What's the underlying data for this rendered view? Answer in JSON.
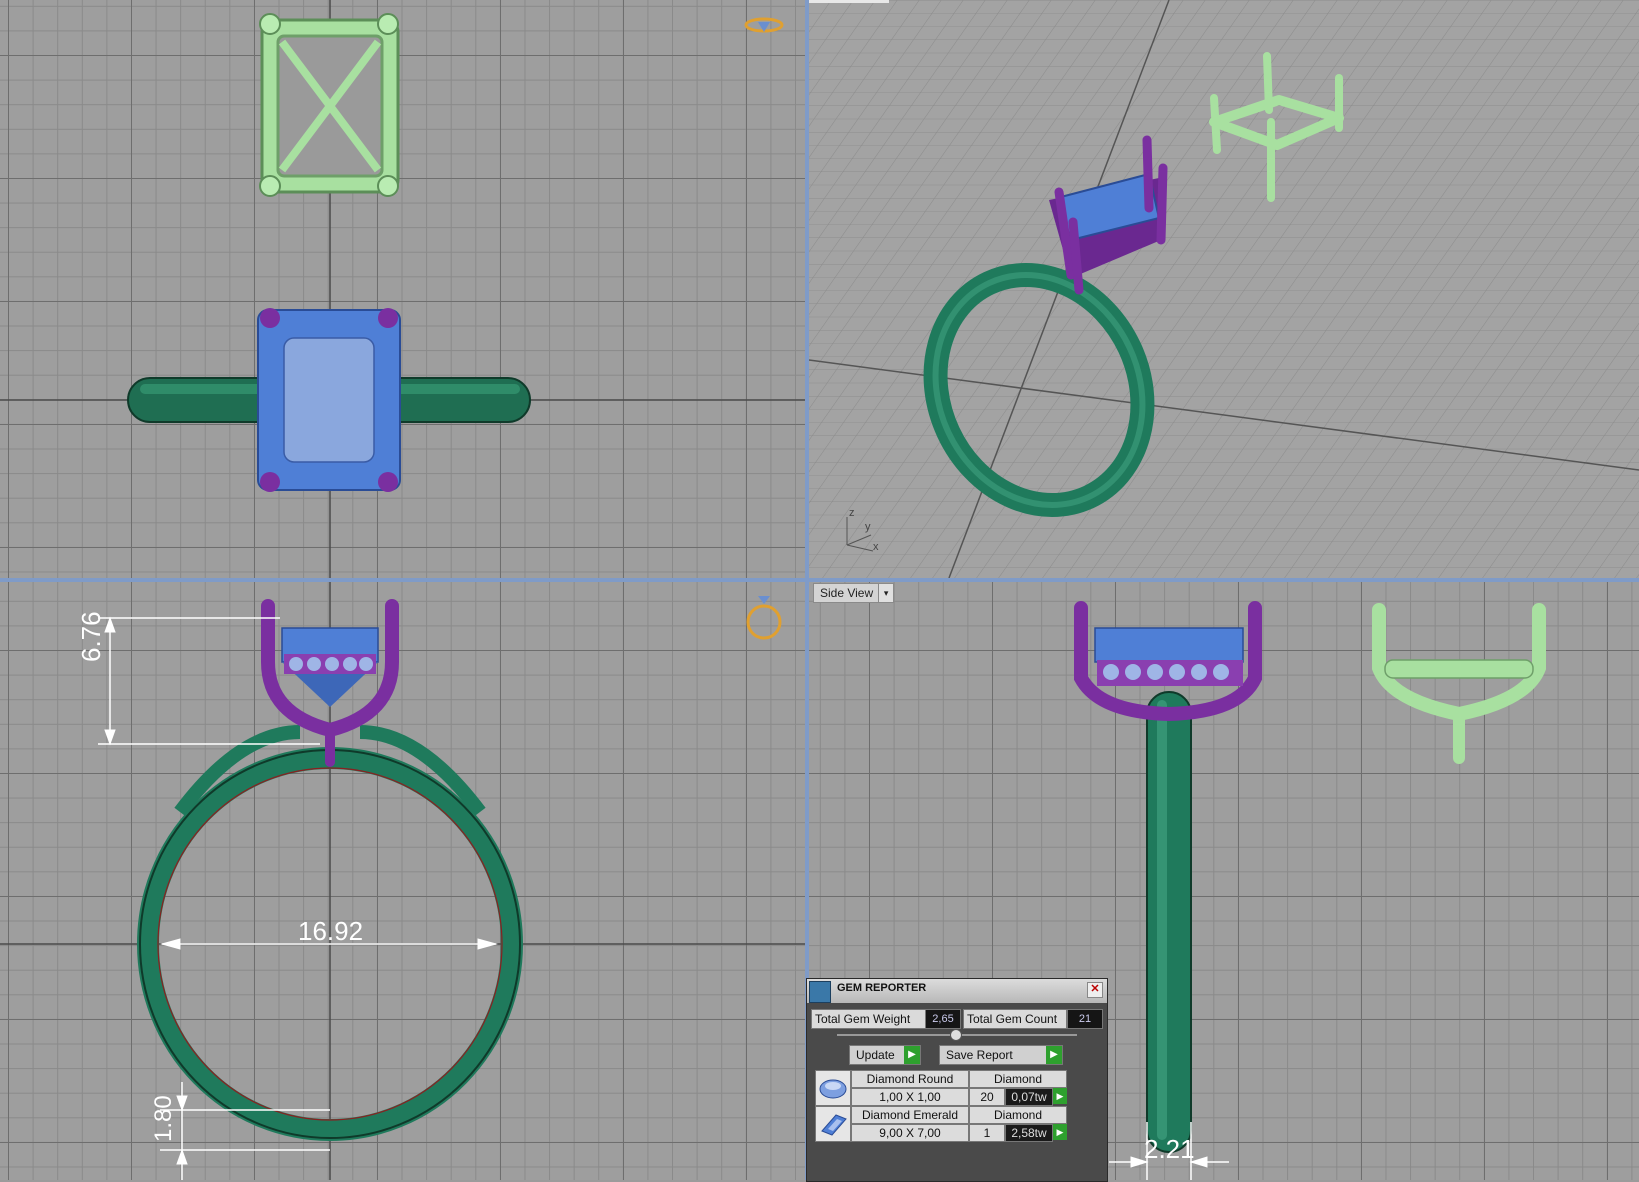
{
  "viewports": {
    "side_label": "Side View",
    "side_dropdown_glyph": "▾"
  },
  "dimensions": {
    "height": "6.76",
    "inner_diameter": "16.92",
    "band_thickness": "1.80",
    "band_width": "2.21"
  },
  "axes": {
    "x": "x",
    "y": "y",
    "z": "z"
  },
  "gem_reporter": {
    "title": "GEM REPORTER",
    "close_glyph": "✕",
    "total_weight_label": "Total Gem Weight",
    "total_weight_value": "2,65",
    "total_count_label": "Total Gem Count",
    "total_count_value": "21",
    "update_label": "Update",
    "save_report_label": "Save Report",
    "play_glyph": "▶",
    "gems": [
      {
        "name": "Diamond Round",
        "material": "Diamond",
        "size": "1,00 X 1,00",
        "count": "20",
        "weight": "0,07tw",
        "icon": "round-gem-icon"
      },
      {
        "name": "Diamond Emerald",
        "material": "Diamond",
        "size": "9,00 X 7,00",
        "count": "1",
        "weight": "2,58tw",
        "icon": "emerald-gem-icon"
      }
    ]
  },
  "colors": {
    "band": "#1f7a5c",
    "head": "#7a2fa0",
    "gem": "#4f7fd6",
    "mount_preview": "#a8e0a0",
    "panel": "#4a4a4a"
  }
}
